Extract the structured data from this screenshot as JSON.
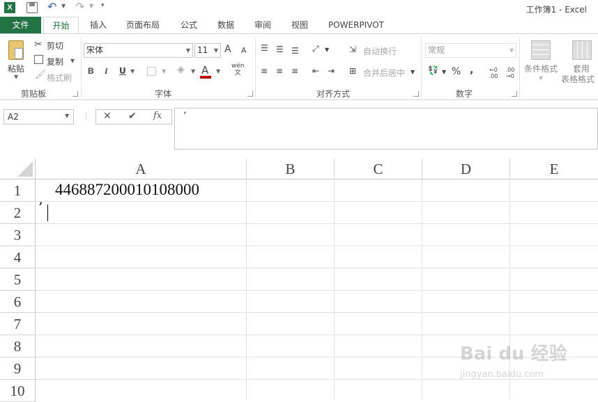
{
  "title": "工作簿1 - Excel",
  "qat": {
    "save_icon": "save-icon",
    "undo_icon": "undo-icon",
    "redo_icon": "redo-icon"
  },
  "tabs": [
    "文件",
    "开始",
    "插入",
    "页面布局",
    "公式",
    "数据",
    "审阅",
    "视图",
    "POWERPIVOT"
  ],
  "ribbon": {
    "clipboard": {
      "paste": "粘贴",
      "cut": "剪切",
      "copy": "复制",
      "format_painter": "格式刷",
      "label": "剪贴板"
    },
    "font": {
      "name": "宋体",
      "size": "11",
      "bold": "B",
      "italic": "I",
      "underline": "U",
      "grow": "A",
      "shrink": "A",
      "font_color": "A",
      "phonetic_top": "wén",
      "phonetic_bottom": "文",
      "label": "字体"
    },
    "alignment": {
      "wrap": "自动换行",
      "merge": "合并后居中",
      "label": "对齐方式"
    },
    "number": {
      "format": "常规",
      "percent": "%",
      "comma": ",",
      "dec_inc": "←0 .00",
      "dec_dec": ".00 →0",
      "label": "数字"
    },
    "styles": {
      "conditional": "条件格式",
      "table_line1": "套用",
      "table_line2": "表格格式"
    }
  },
  "formula_bar": {
    "name_box": "A2",
    "cancel": "✕",
    "enter": "✔",
    "fx": "fx",
    "value": "’"
  },
  "columns": [
    "A",
    "B",
    "C",
    "D",
    "E"
  ],
  "rows": [
    "1",
    "2",
    "3",
    "4",
    "5",
    "6",
    "7",
    "8",
    "9",
    "10"
  ],
  "cells": {
    "A1": "446887200010108000",
    "A2": "’"
  },
  "colors": {
    "accent": "#217346",
    "font_red": "#c00000"
  },
  "watermark": {
    "brand": "Bai du 经验",
    "url": "jingyan.baidu.com"
  }
}
